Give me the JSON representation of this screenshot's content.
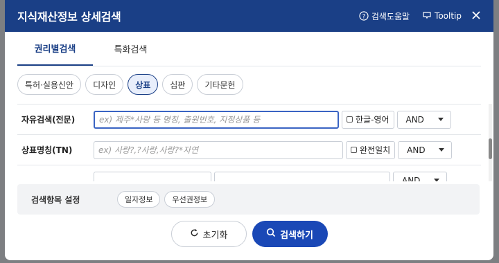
{
  "header": {
    "title": "지식재산정보 상세검색",
    "help_label": "검색도움말",
    "tooltip_label": "Tooltip"
  },
  "tabs": [
    {
      "label": "권리별검색",
      "active": true
    },
    {
      "label": "특화검색",
      "active": false
    }
  ],
  "chips": [
    {
      "label": "특허·실용신안",
      "active": false
    },
    {
      "label": "디자인",
      "active": false
    },
    {
      "label": "상표",
      "active": true
    },
    {
      "label": "심판",
      "active": false
    },
    {
      "label": "기타문헌",
      "active": false
    }
  ],
  "rows": [
    {
      "label": "자유검색(전문)",
      "placeholder": "ex) 제주*사랑 등 명칭, 출원번호, 지정상품 등",
      "check_label": "한글-영어",
      "operator": "AND"
    },
    {
      "label": "상표명칭(TN)",
      "placeholder": "ex) 사랑?,?사랑,사랑?*자연",
      "check_label": "완전일치",
      "operator": "AND"
    },
    {
      "label": "",
      "placeholder": "",
      "check_label": "",
      "operator": "AND"
    }
  ],
  "settings": {
    "label": "검색항목 설정",
    "pills": [
      "일자정보",
      "우선권정보"
    ]
  },
  "actions": {
    "reset_label": "초기화",
    "search_label": "검색하기"
  },
  "colors": {
    "primary": "#1a3f86",
    "search_button": "#1a48b6"
  }
}
